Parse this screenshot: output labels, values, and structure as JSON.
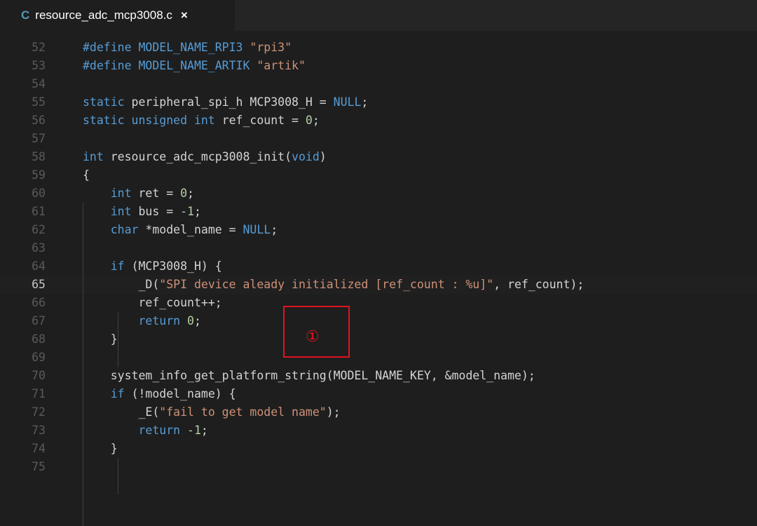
{
  "tab": {
    "icon": "C",
    "filename": "resource_adc_mcp3008.c",
    "close": "×"
  },
  "lines": [
    {
      "num": "52",
      "tokens": [
        {
          "t": "#define MODEL_NAME_RPI3 ",
          "c": "k"
        },
        {
          "t": "\"rpi3\"",
          "c": "s"
        }
      ]
    },
    {
      "num": "53",
      "tokens": [
        {
          "t": "#define MODEL_NAME_ARTIK ",
          "c": "k"
        },
        {
          "t": "\"artik\"",
          "c": "s"
        }
      ]
    },
    {
      "num": "54",
      "tokens": []
    },
    {
      "num": "55",
      "tokens": [
        {
          "t": "static ",
          "c": "k"
        },
        {
          "t": "peripheral_spi_h MCP3008_H = "
        },
        {
          "t": "NULL",
          "c": "k"
        },
        {
          "t": ";"
        }
      ]
    },
    {
      "num": "56",
      "tokens": [
        {
          "t": "static unsigned int ",
          "c": "k"
        },
        {
          "t": "ref_count = "
        },
        {
          "t": "0",
          "c": "n"
        },
        {
          "t": ";"
        }
      ]
    },
    {
      "num": "57",
      "tokens": []
    },
    {
      "num": "58",
      "tokens": [
        {
          "t": "int ",
          "c": "k"
        },
        {
          "t": "resource_adc_mcp3008_init("
        },
        {
          "t": "void",
          "c": "k"
        },
        {
          "t": ")"
        }
      ]
    },
    {
      "num": "59",
      "tokens": [
        {
          "t": "{"
        }
      ]
    },
    {
      "num": "60",
      "tokens": [
        {
          "t": "    "
        },
        {
          "t": "int ",
          "c": "k"
        },
        {
          "t": "ret = "
        },
        {
          "t": "0",
          "c": "n"
        },
        {
          "t": ";"
        }
      ]
    },
    {
      "num": "61",
      "tokens": [
        {
          "t": "    "
        },
        {
          "t": "int ",
          "c": "k"
        },
        {
          "t": "bus = "
        },
        {
          "t": "-1",
          "c": "n"
        },
        {
          "t": ";"
        }
      ]
    },
    {
      "num": "62",
      "tokens": [
        {
          "t": "    "
        },
        {
          "t": "char ",
          "c": "k"
        },
        {
          "t": "*model_name = "
        },
        {
          "t": "NULL",
          "c": "k"
        },
        {
          "t": ";"
        }
      ]
    },
    {
      "num": "63",
      "tokens": []
    },
    {
      "num": "64",
      "tokens": [
        {
          "t": "    "
        },
        {
          "t": "if ",
          "c": "k"
        },
        {
          "t": "(MCP3008_H) {"
        }
      ]
    },
    {
      "num": "65",
      "current": true,
      "tokens": [
        {
          "t": "        _D("
        },
        {
          "t": "\"SPI device aleady initialized [ref_count : %u]\"",
          "c": "s"
        },
        {
          "t": ", ref_count);"
        }
      ]
    },
    {
      "num": "66",
      "tokens": [
        {
          "t": "        ref_count++;"
        }
      ]
    },
    {
      "num": "67",
      "tokens": [
        {
          "t": "        "
        },
        {
          "t": "return ",
          "c": "k"
        },
        {
          "t": "0",
          "c": "n"
        },
        {
          "t": ";"
        }
      ]
    },
    {
      "num": "68",
      "tokens": [
        {
          "t": "    }"
        }
      ]
    },
    {
      "num": "69",
      "tokens": []
    },
    {
      "num": "70",
      "tokens": [
        {
          "t": "    system_info_get_platform_string(MODEL_NAME_KEY, &model_name);"
        }
      ]
    },
    {
      "num": "71",
      "tokens": [
        {
          "t": "    "
        },
        {
          "t": "if ",
          "c": "k"
        },
        {
          "t": "(!model_name) {"
        }
      ]
    },
    {
      "num": "72",
      "tokens": [
        {
          "t": "        _E("
        },
        {
          "t": "\"fail to get model name\"",
          "c": "s"
        },
        {
          "t": ");"
        }
      ]
    },
    {
      "num": "73",
      "tokens": [
        {
          "t": "        "
        },
        {
          "t": "return ",
          "c": "k"
        },
        {
          "t": "-1",
          "c": "n"
        },
        {
          "t": ";"
        }
      ]
    },
    {
      "num": "74",
      "tokens": [
        {
          "t": "    }"
        }
      ]
    },
    {
      "num": "75",
      "tokens": []
    }
  ],
  "annotation": {
    "marker": "①",
    "color": "#e0141e"
  },
  "colors": {
    "keyword": "#569cd6",
    "string": "#ce9178",
    "number": "#b5cea8",
    "text": "#d4d4d4",
    "line_number": "#5a5a5a",
    "background": "#1e1e1e"
  }
}
